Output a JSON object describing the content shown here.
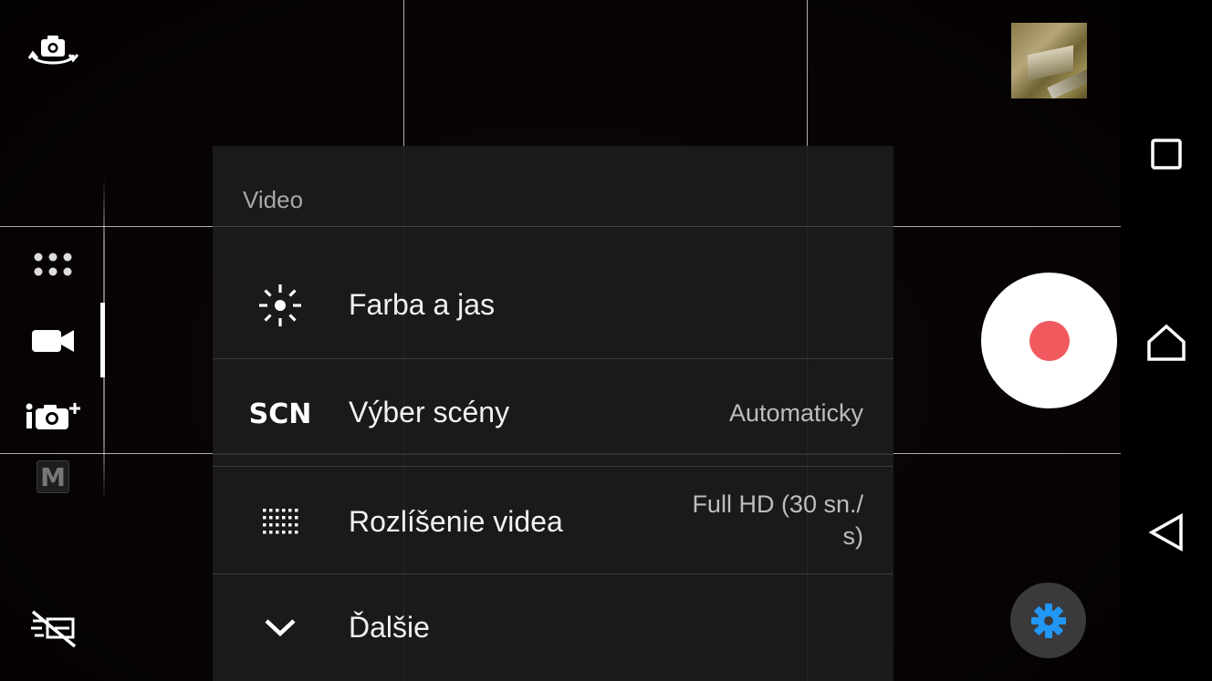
{
  "panel": {
    "title": "Video",
    "rows": [
      {
        "icon": "brightness-icon",
        "label": "Farba a jas",
        "value": ""
      },
      {
        "icon_text": "SCN",
        "label": "Výber scény",
        "value": "Automaticky"
      },
      {
        "icon": "resolution-grid-icon",
        "label": "Rozlíšenie videa",
        "value_line1": "Full HD (30 sn./",
        "value_line2": "s)"
      },
      {
        "icon": "chevron-down-icon",
        "label": "Ďalšie",
        "value": ""
      }
    ]
  },
  "left_rail": {
    "icons": [
      "switch-camera-icon",
      "more-modes-icon",
      "video-camera-icon",
      "superior-auto-camera-icon",
      "manual-mode-icon",
      "location-off-icon"
    ],
    "manual_letter": "M"
  },
  "right_rail": {
    "icons": [
      "gallery-thumbnail",
      "record-button",
      "settings-gear-icon"
    ]
  },
  "navbar": {
    "icons": [
      "recent-apps-icon",
      "home-icon",
      "back-icon"
    ]
  },
  "colors": {
    "record_dot": "#f05a5f",
    "settings_gear": "#2196f3",
    "panel_bg": "#1c1c1c"
  }
}
